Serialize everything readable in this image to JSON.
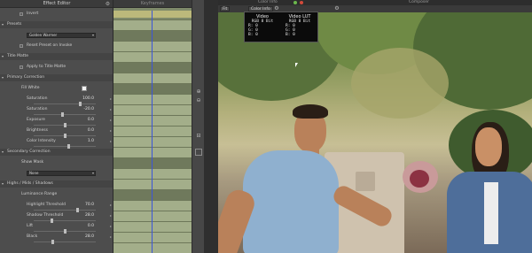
{
  "effect_editor": {
    "title": "Effect Editor",
    "close_icon": "gear-icon",
    "rows": [
      {
        "type": "check",
        "label": "Invert"
      },
      {
        "type": "section",
        "label": "Presets"
      },
      {
        "type": "dropdown",
        "value": "Golden Warmer"
      },
      {
        "type": "check",
        "label": "Reset Preset on Invoke"
      },
      {
        "type": "section",
        "label": "Title Matte"
      },
      {
        "type": "check",
        "label": "Apply to Title Matte"
      },
      {
        "type": "section",
        "label": "Primary Correction"
      },
      {
        "type": "swatch",
        "label": "Fill White",
        "color": "#f2f2f2"
      },
      {
        "type": "slider",
        "label": "Saturation",
        "value": "100.0",
        "pos": 0.74
      },
      {
        "type": "slider",
        "label": "Saturation",
        "value": "-20.0",
        "pos": 0.45
      },
      {
        "type": "slider",
        "label": "Exposure",
        "value": "0.0",
        "pos": 0.5
      },
      {
        "type": "slider",
        "label": "Brightness",
        "value": "0.0",
        "pos": 0.5
      },
      {
        "type": "slider",
        "label": "Color Intensity",
        "value": "1.0",
        "pos": 0.55
      },
      {
        "type": "section",
        "label": "Secondary Correction"
      },
      {
        "type": "plain",
        "label": "Show Mask"
      },
      {
        "type": "dropdown",
        "value": "None"
      },
      {
        "type": "section",
        "label": "Highs / Mids / Shadows"
      },
      {
        "type": "plain",
        "label": "Luminance Range"
      },
      {
        "type": "slider",
        "label": "Highlight Threshold",
        "value": "70.0",
        "pos": 0.7
      },
      {
        "type": "slider",
        "label": "Shadow Threshold",
        "value": "28.0",
        "pos": 0.28
      },
      {
        "type": "slider",
        "label": "Lift",
        "value": "0.0",
        "pos": 0.5
      },
      {
        "type": "slider",
        "label": "Black",
        "value": "28.0",
        "pos": 0.3
      }
    ]
  },
  "keyframes": {
    "header": "Keyframes"
  },
  "top_bar": {
    "left_label": "Color Info",
    "right_label": "Composer"
  },
  "viewer_toolbar": {
    "scale_button": "Fit",
    "info_button": "Color Info"
  },
  "readout": {
    "left": {
      "header": "Video",
      "lines": [
        "RGB 8 Bit",
        "R: 0",
        "G: 0",
        "B: 0"
      ]
    },
    "right": {
      "header": "Video LUT",
      "lines": [
        "RGB 8 Bit",
        "R: 0",
        "G: 0",
        "B: 0"
      ]
    }
  },
  "colors": {
    "panel": "#4d4d4d",
    "keyframe_band": "#a3ae8a",
    "playhead": "#3b55d8",
    "readout_bg": "#0b0b0b"
  }
}
